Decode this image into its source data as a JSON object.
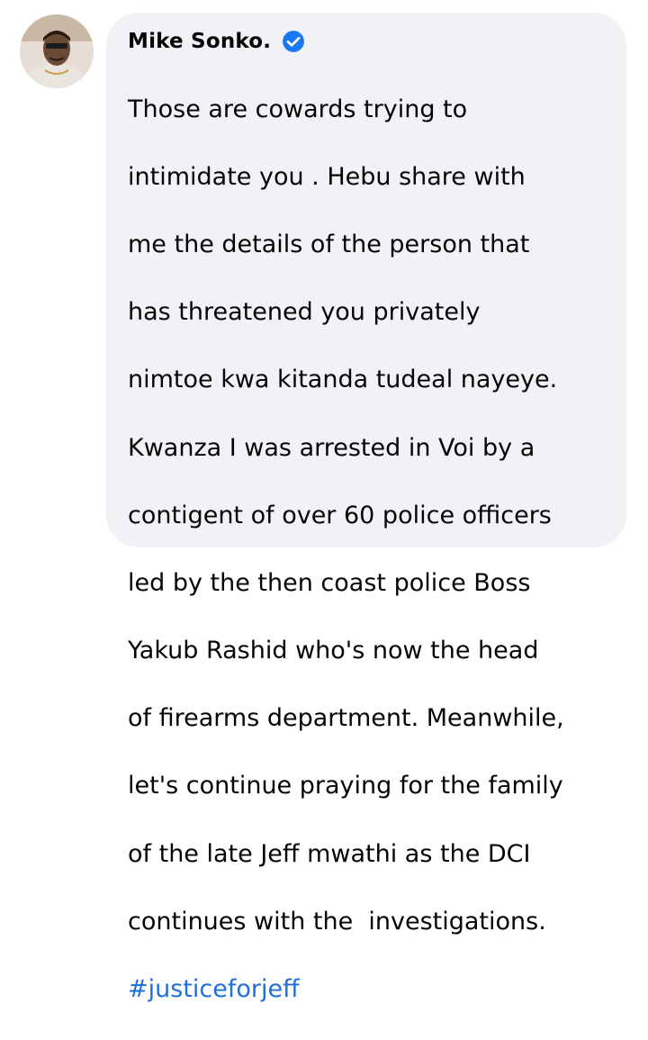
{
  "comment": {
    "author": "Mike Sonko.",
    "verified_icon": "verified-badge-icon",
    "lines": [
      "Those are cowards trying to",
      "intimidate you . Hebu share with",
      "me the details of the person that",
      "has threatened you privately",
      "nimtoe kwa kitanda tudeal nayeye.",
      "Kwanza I was arrested in Voi by a",
      "contigent of over 60 police officers",
      "led by the then coast police Boss",
      "Yakub Rashid who's now the head",
      "of firearms department. Meanwhile,",
      "let's continue praying for the family",
      "of the late Jeff mwathi as the DCI",
      "continues with the  investigations."
    ],
    "hashtag": "#justiceforjeff"
  },
  "colors": {
    "bubble_background": "#f0f2f5",
    "text": "#050505",
    "hashtag": "#216fdb",
    "verified_badge": "#1877f2"
  }
}
